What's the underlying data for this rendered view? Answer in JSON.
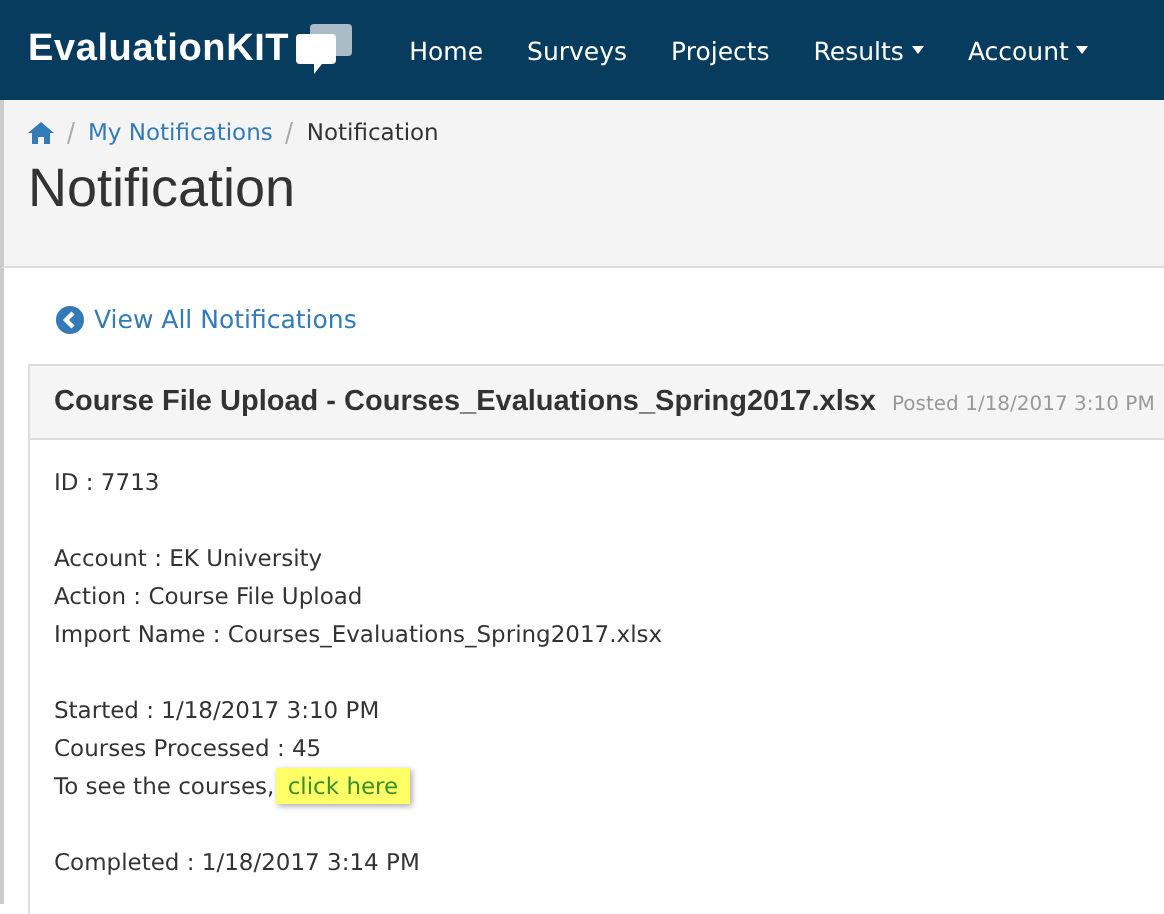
{
  "brand": {
    "name": "EvaluationKIT"
  },
  "nav": [
    {
      "label": "Home",
      "dropdown": false
    },
    {
      "label": "Surveys",
      "dropdown": false
    },
    {
      "label": "Projects",
      "dropdown": false
    },
    {
      "label": "Results",
      "dropdown": true
    },
    {
      "label": "Account",
      "dropdown": true
    }
  ],
  "breadcrumb": [
    {
      "label": "My Notifications",
      "link": true
    },
    {
      "label": "Notification",
      "link": false
    }
  ],
  "page_title": "Notification",
  "back_link": "View All Notifications",
  "panel": {
    "title": "Course File Upload - Courses_Evaluations_Spring2017.xlsx",
    "posted": "Posted 1/18/2017 3:10 PM",
    "groups": [
      [
        {
          "text": "ID : 7713"
        }
      ],
      [
        {
          "text": "Account : EK University"
        },
        {
          "text": "Action : Course File Upload"
        },
        {
          "text": "Import Name : Courses_Evaluations_Spring2017.xlsx"
        }
      ],
      [
        {
          "text": "Started : 1/18/2017 3:10 PM"
        },
        {
          "text": "Courses Processed : 45"
        },
        {
          "text": "To see the courses,",
          "link": "click here",
          "highlighted": true
        }
      ],
      [
        {
          "text": "Completed : 1/18/2017 3:14 PM"
        }
      ]
    ]
  }
}
